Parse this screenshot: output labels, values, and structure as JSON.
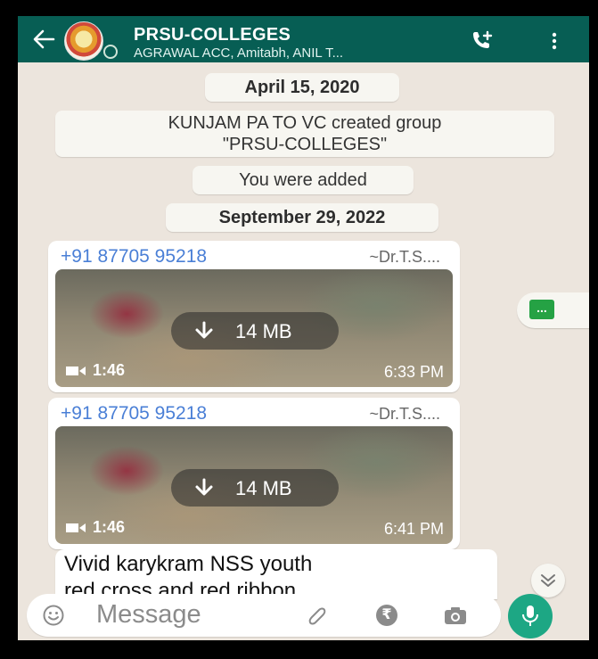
{
  "header": {
    "title": "PRSU-COLLEGES",
    "members": "AGRAWAL ACC, Amitabh, ANIL T..."
  },
  "system": {
    "date1": "April 15, 2020",
    "created_line1": "KUNJAM PA TO VC created group",
    "created_line2": "\"PRSU-COLLEGES\"",
    "added": "You were added",
    "date2": "September 29, 2022"
  },
  "messages": [
    {
      "sender_phone": "+91 87705 95218",
      "sender_name": "~Dr.T.S....",
      "size": "14 MB",
      "duration": "1:46",
      "time": "6:33 PM"
    },
    {
      "sender_phone": "+91 87705 95218",
      "sender_name": "~Dr.T.S....",
      "size": "14 MB",
      "duration": "1:46",
      "time": "6:41 PM"
    }
  ],
  "text_message": {
    "line1": "Vivid karykram NSS youth",
    "line2": "red cross and red  ribbon"
  },
  "side": {
    "more_label": "..."
  },
  "input": {
    "placeholder": "Message",
    "currency_symbol": "₹"
  },
  "colors": {
    "header": "#075e54",
    "accent": "#1da784",
    "sender": "#4a7fd6"
  }
}
